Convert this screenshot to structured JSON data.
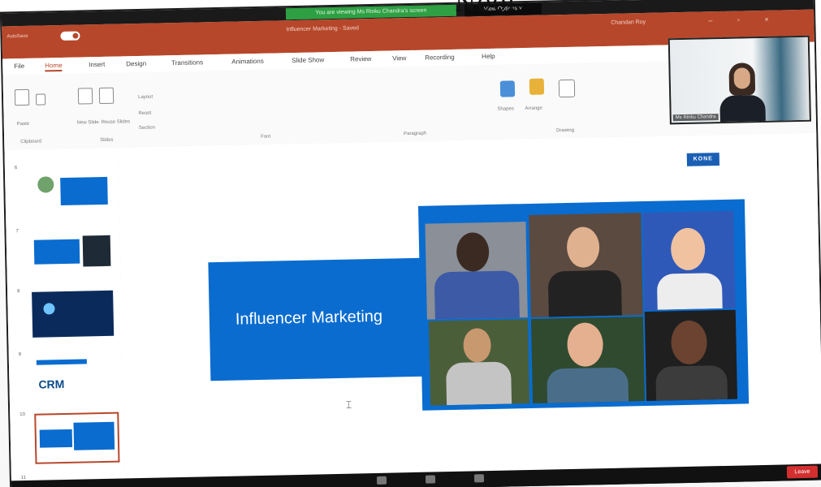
{
  "handwriting": "Neel",
  "zoom": {
    "banner": "You are viewing Ms Rinku Chandra's screen",
    "view_options": "View Options ˅",
    "participant_name": "Ms Rinku Chandra",
    "leave_button": "Leave"
  },
  "ppt": {
    "autosave_label": "AutoSave",
    "document_title": "Influencer Marketing - Saved",
    "user": "Chandan Roy",
    "window_controls": "– ▫ ×",
    "tabs": [
      "File",
      "Home",
      "Insert",
      "Design",
      "Transitions",
      "Animations",
      "Slide Show",
      "Review",
      "View",
      "Recording",
      "Help"
    ],
    "ribbon_labels": {
      "paste": "Paste",
      "clipboard": "Clipboard",
      "new_slide": "New Slide",
      "reuse_slides": "Reuse Slides",
      "layout": "Layout",
      "reset": "Reset",
      "section": "Section",
      "slides": "Slides",
      "font": "Font",
      "paragraph": "Paragraph",
      "shapes": "Shapes",
      "arrange": "Arrange",
      "drawing": "Drawing"
    }
  },
  "thumbnails": [
    {
      "number": "6"
    },
    {
      "number": "7"
    },
    {
      "number": "8"
    },
    {
      "number": "9",
      "text": "CRM"
    },
    {
      "number": "10"
    },
    {
      "number": "11"
    }
  ],
  "slide": {
    "title": "Influencer Marketing",
    "logo": "KONE"
  },
  "colors": {
    "ppt_red": "#b7472a",
    "slide_blue": "#0a6ccf",
    "zoom_green": "#2ea043",
    "leave_red": "#d32f2f"
  }
}
